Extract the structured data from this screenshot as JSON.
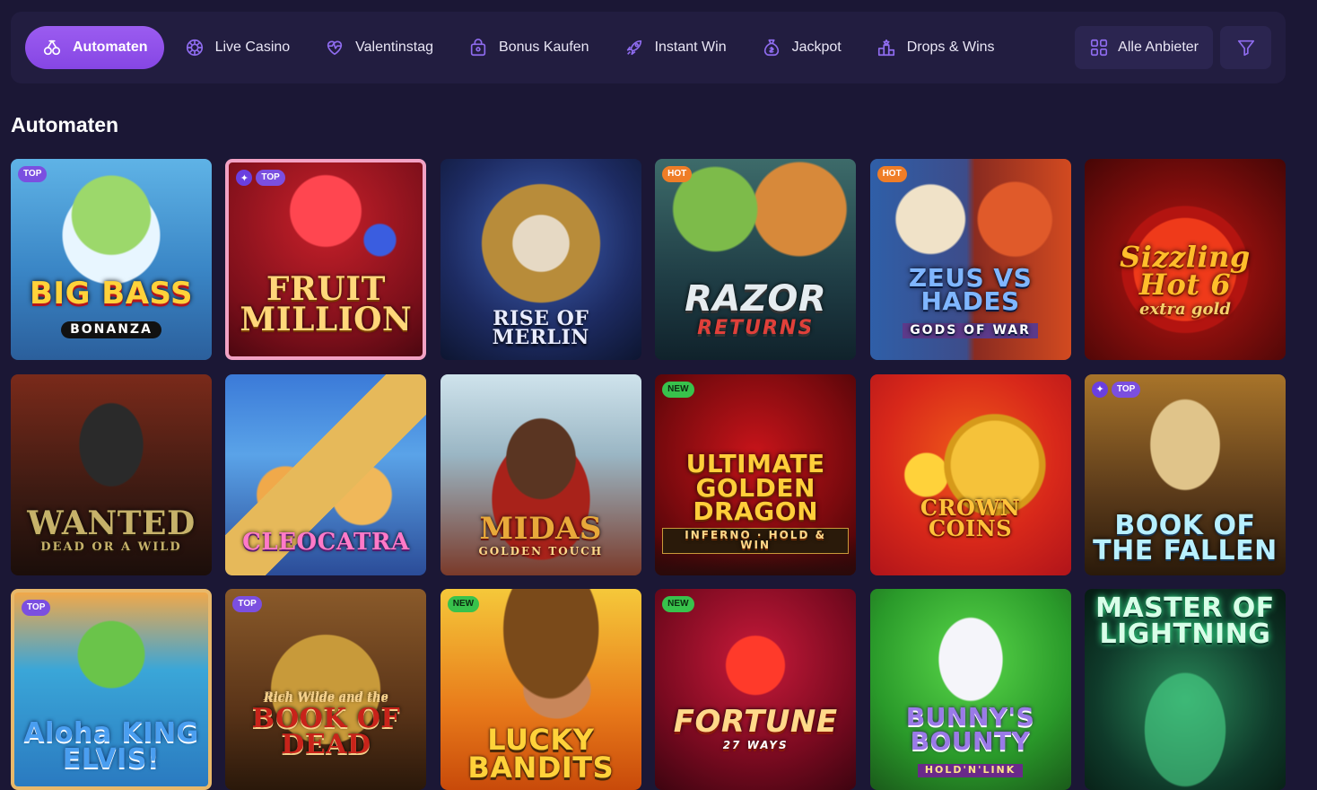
{
  "nav": {
    "items": [
      {
        "label": "Automaten",
        "icon": "slot-machine-icon",
        "active": true
      },
      {
        "label": "Live Casino",
        "icon": "roulette-icon",
        "active": false
      },
      {
        "label": "Valentinstag",
        "icon": "heart-icon",
        "active": false
      },
      {
        "label": "Bonus Kaufen",
        "icon": "gift-bag-icon",
        "active": false
      },
      {
        "label": "Instant Win",
        "icon": "rocket-icon",
        "active": false
      },
      {
        "label": "Jackpot",
        "icon": "money-bag-icon",
        "active": false
      },
      {
        "label": "Drops & Wins",
        "icon": "podium-icon",
        "active": false
      }
    ],
    "providers_label": "Alle Anbieter",
    "providers_icon": "grid-icon",
    "filter_icon": "filter-icon"
  },
  "section": {
    "title": "Automaten"
  },
  "colors": {
    "background": "#1b1735",
    "nav_background": "#221d40",
    "accent": "#8f52ea",
    "badge_top": "#7b4fe0",
    "badge_hot": "#ef7d27",
    "badge_new": "#38c24c"
  },
  "games": [
    {
      "title": "BIG BASS",
      "subtitle": "BONANZA",
      "badge": "TOP",
      "star": false
    },
    {
      "title": "FRUIT MILLION",
      "subtitle": "",
      "badge": "TOP",
      "star": true
    },
    {
      "title": "RISE OF MERLIN",
      "subtitle": "",
      "badge": "",
      "star": false
    },
    {
      "title": "RAZOR",
      "subtitle": "RETURNS",
      "badge": "HOT",
      "star": false
    },
    {
      "title": "ZEUS VS HADES",
      "subtitle": "GODS OF WAR",
      "badge": "HOT",
      "star": false
    },
    {
      "title": "Sizzling Hot 6",
      "subtitle": "extra gold",
      "badge": "",
      "star": false
    },
    {
      "title": "WANTED",
      "subtitle": "DEAD OR A WILD",
      "badge": "",
      "star": false
    },
    {
      "title": "CLEOCATRA",
      "subtitle": "",
      "badge": "",
      "star": false
    },
    {
      "title": "MIDAS",
      "subtitle": "GOLDEN TOUCH",
      "badge": "",
      "star": false
    },
    {
      "title": "ULTIMATE GOLDEN DRAGON",
      "subtitle": "INFERNO · HOLD & WIN",
      "badge": "NEW",
      "star": false
    },
    {
      "title": "CROWN COINS",
      "subtitle": "",
      "badge": "",
      "star": false
    },
    {
      "title": "BOOK OF THE FALLEN",
      "subtitle": "",
      "badge": "TOP",
      "star": true
    },
    {
      "title": "Aloha KING ELVIS!",
      "subtitle": "",
      "badge": "TOP",
      "star": false
    },
    {
      "title": "BOOK OF DEAD",
      "subtitle": "Rich Wilde and the",
      "badge": "TOP",
      "star": false
    },
    {
      "title": "LUCKY BANDITS",
      "subtitle": "",
      "badge": "NEW",
      "star": false
    },
    {
      "title": "FORTUNE",
      "subtitle": "27 WAYS",
      "badge": "NEW",
      "star": false
    },
    {
      "title": "BUNNY'S BOUNTY",
      "subtitle": "HOLD'N'LINK",
      "badge": "",
      "star": false
    },
    {
      "title": "MASTER OF LIGHTNING",
      "subtitle": "",
      "badge": "",
      "star": false
    }
  ]
}
